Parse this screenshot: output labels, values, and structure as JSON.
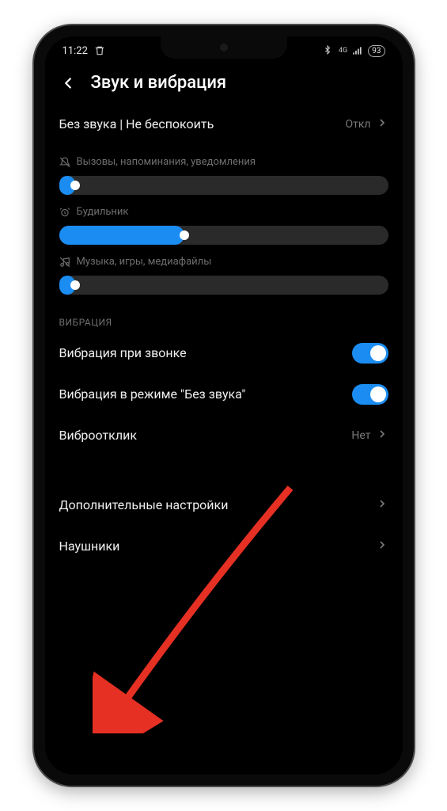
{
  "status": {
    "time": "11:22",
    "battery": "93"
  },
  "header": {
    "title": "Звук и вибрация"
  },
  "dnd": {
    "label": "Без звука | Не беспокоить",
    "value": "Откл"
  },
  "sliders": {
    "calls": {
      "label": "Вызовы, напоминания, уведомления",
      "percent": 5
    },
    "alarm": {
      "label": "Будильник",
      "percent": 38
    },
    "media": {
      "label": "Музыка, игры, медиафайлы",
      "percent": 5
    }
  },
  "vibration": {
    "section": "ВИБРАЦИЯ",
    "on_call": {
      "label": "Вибрация при звонке",
      "on": true
    },
    "silent": {
      "label": "Вибрация в режиме \"Без звука\"",
      "on": true
    },
    "haptic": {
      "label": "Виброотклик",
      "value": "Нет"
    }
  },
  "more": {
    "advanced": "Дополнительные настройки",
    "headphones": "Наушники"
  }
}
